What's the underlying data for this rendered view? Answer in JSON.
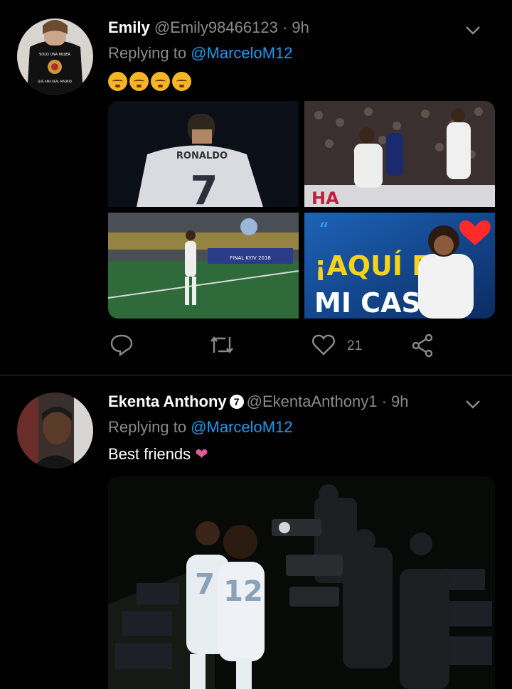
{
  "tweets": [
    {
      "name": "Emily",
      "handle": "@Emily98466123",
      "separator": "·",
      "time": "9h",
      "replying_prefix": "Replying to",
      "replying_to": "@MarceloM12",
      "emoji_count": 4,
      "media": [
        {
          "label": "RONALDO",
          "number": "7"
        },
        {
          "label": "match-photo",
          "banner_text": "HA"
        },
        {
          "label": "stadium-photo",
          "banner_text": "FINAL KYIV 2018"
        },
        {
          "label": "quote-card",
          "line1": "¡AQUÍ ES",
          "line2": "MI CASA!"
        }
      ],
      "like_count": "21"
    },
    {
      "name": "Ekenta Anthony",
      "badge": "7",
      "handle": "@EkentaAnthony1",
      "separator": "·",
      "time": "9h",
      "replying_prefix": "Replying to",
      "replying_to": "@MarceloM12",
      "text": "Best friends",
      "media_numbers": [
        "7",
        "12"
      ]
    }
  ],
  "colors": {
    "background": "#000000",
    "mention": "#1d9bf0",
    "muted": "#8b8b8b",
    "divider": "#2f3336"
  },
  "icons": [
    "chevron-down-icon",
    "reply-icon",
    "retweet-icon",
    "like-icon",
    "share-icon"
  ]
}
